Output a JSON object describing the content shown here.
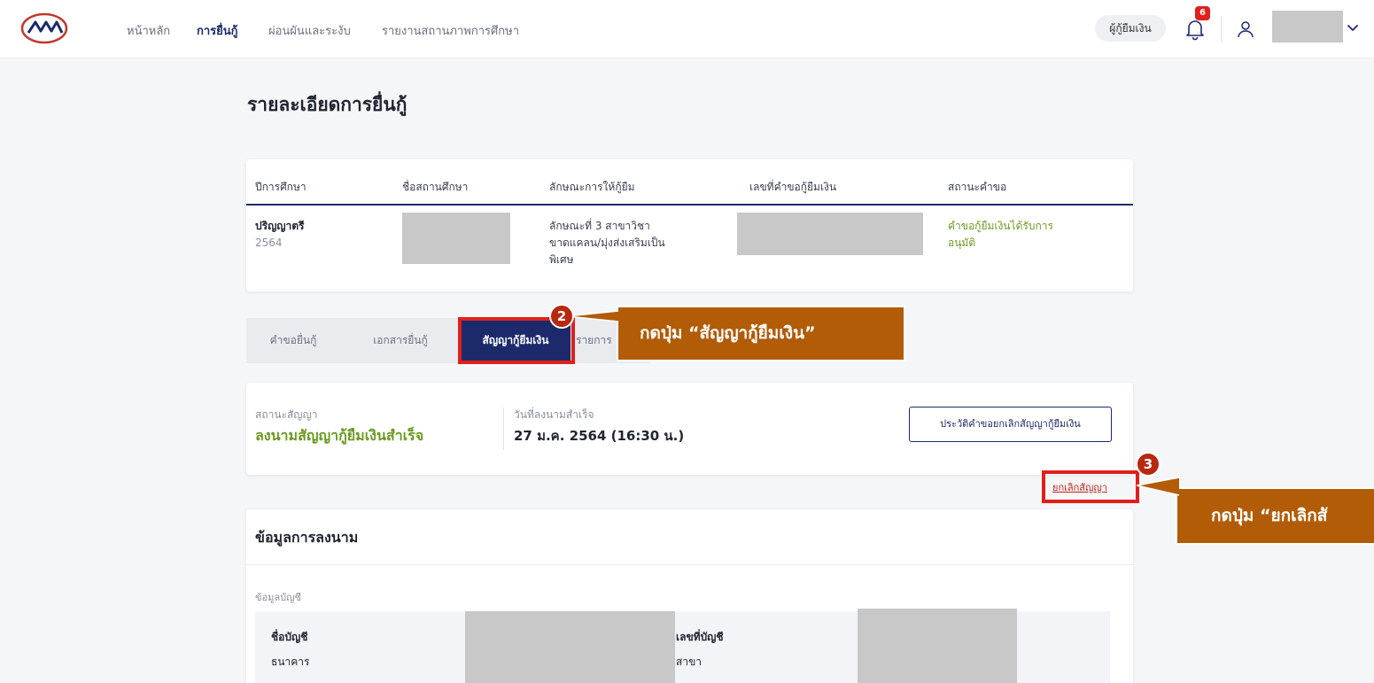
{
  "header": {
    "logo_icon": "agency-logo-icon",
    "nav": [
      {
        "label": "หน้าหลัก",
        "active": false
      },
      {
        "label": "การยื่นกู้",
        "active": true
      },
      {
        "label": "ผ่อนผันและระงับ",
        "active": false
      },
      {
        "label": "รายงานสถานภาพการศึกษา",
        "active": false
      }
    ],
    "role_label": "ผู้กู้ยืมเงิน",
    "notification_count": "6",
    "icons": {
      "bell": "bell-icon",
      "user": "user-icon",
      "chevron": "chevron-down-icon"
    }
  },
  "page": {
    "title": "รายละเอียดการยื่นกู้"
  },
  "info_table": {
    "headers": [
      "ปีการศึกษา",
      "ชื่อสถานศึกษา",
      "ลักษณะการให้กู้ยืม",
      "เลขที่คำขอกู้ยืมเงิน",
      "สถานะคำขอ"
    ],
    "row": {
      "degree": "ปริญญาตรี",
      "year": "2564",
      "loan_type_lines": [
        "ลักษณะที่ 3 สาขาวิชา",
        "ขาดแคลน/มุ่งส่งเสริมเป็น",
        "พิเศษ"
      ],
      "status_lines": [
        "คำขอกู้ยืมเงินได้รับการ",
        "อนุมัติ"
      ]
    }
  },
  "tabs": [
    {
      "label": "คำขอยื่นกู้",
      "active": false
    },
    {
      "label": "เอกสารยื่นกู้",
      "active": false
    },
    {
      "label": "สัญญากู้ยืมเงิน",
      "active": true
    },
    {
      "label": "รายการ",
      "active": false
    }
  ],
  "callouts": {
    "step2": {
      "number": "2",
      "text": "กดปุ่ม “สัญญากู้ยืมเงิน”"
    },
    "step3": {
      "number": "3",
      "text": "กดปุ่ม “ยกเลิกสั"
    }
  },
  "contract": {
    "status_label": "สถานะสัญญา",
    "status_value": "ลงนามสัญญากู้ยืมเงินสำเร็จ",
    "date_label": "วันที่ลงนามสำเร็จ",
    "date_value": "27 ม.ค. 2564 (16:30 น.)",
    "history_button": "ประวัติคำขอยกเลิกสัญญากู้ยืมเงิน",
    "cancel_link": "ยกเลิกสัญญา"
  },
  "signing": {
    "title": "ข้อมูลการลงนาม",
    "section_label": "ข้อมูลบัญชี",
    "fields": {
      "account_name": "ชื่อบัญชี",
      "bank": "ธนาคาร",
      "account_number": "เลขที่บัญชี",
      "branch": "สาขา"
    }
  },
  "colors": {
    "brand_navy": "#1c2a6b",
    "success_green": "#6a9a1f",
    "highlight_red": "#e0201b",
    "callout_brown": "#b25c08"
  }
}
